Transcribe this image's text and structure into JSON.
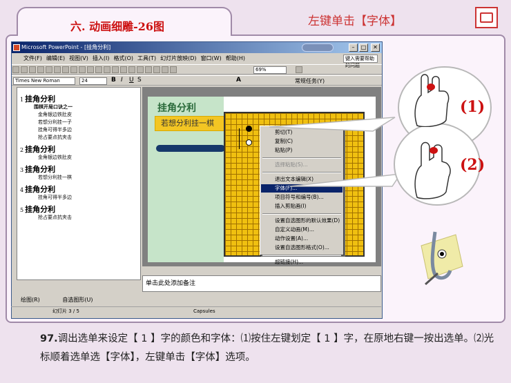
{
  "header": {
    "lesson_title": "六. 动画细雕-26图",
    "action_hint": "左键单击【字体】"
  },
  "icons": {
    "corner": "presentation-slide-icon",
    "mascot": "magnifier-mascot-icon"
  },
  "window": {
    "title": "Microsoft PowerPoint - [挂角分利]",
    "menu": [
      "文件(F)",
      "编辑(E)",
      "视图(V)",
      "插入(I)",
      "格式(O)",
      "工具(T)",
      "幻灯片放映(D)",
      "窗口(W)",
      "帮助(H)"
    ],
    "help_box": "键入需要帮助的问题",
    "font_name": "Times New Roman",
    "font_size": "24",
    "zoom": "69%",
    "task_pane": "常规任务(Y)",
    "notes_placeholder": "单击此处添加备注",
    "status_slide": "幻灯片 3 / 5",
    "status_design": "Capsules",
    "draw_label": "绘图(R)",
    "autoshape_label": "自选图形(U)"
  },
  "outline": [
    {
      "num": "1",
      "title": "挂角分利",
      "subs": [
        "围棋开局口诀之一",
        "金角银边铁肚皮",
        "若想分利挂一子",
        "挂角可得半多边",
        "抢占要点抗夹击"
      ]
    },
    {
      "num": "2",
      "title": "挂角分利",
      "subs": [
        "金角银边铁肚皮"
      ]
    },
    {
      "num": "3",
      "title": "挂角分利",
      "subs": [
        "若想分利挂一棋"
      ]
    },
    {
      "num": "4",
      "title": "挂角分利",
      "subs": [
        "挂角可得半多边"
      ]
    },
    {
      "num": "5",
      "title": "挂角分利",
      "subs": [
        "抢占要点抗夹击"
      ]
    }
  ],
  "slide": {
    "title": "挂角分利",
    "subtitle": "若想分利挂一棋"
  },
  "context_menu": {
    "items": [
      {
        "label": "剪切(T)",
        "state": "normal"
      },
      {
        "label": "复制(C)",
        "state": "normal"
      },
      {
        "label": "粘贴(P)",
        "state": "normal"
      },
      {
        "label": "选择粘贴(S)...",
        "state": "disabled"
      },
      {
        "label": "退出文本编辑(X)",
        "state": "normal"
      },
      {
        "label": "字体(F)...",
        "state": "selected"
      },
      {
        "label": "项目符号和编号(B)...",
        "state": "normal"
      },
      {
        "label": "插入剪贴画(I)",
        "state": "normal"
      },
      {
        "label": "设置自选图形的默认效果(D)",
        "state": "normal"
      },
      {
        "label": "自定义动画(M)...",
        "state": "normal"
      },
      {
        "label": "动作设置(A)...",
        "state": "normal"
      },
      {
        "label": "设置自选图形格式(O)...",
        "state": "normal"
      },
      {
        "label": "超链接(H)...",
        "state": "normal"
      }
    ]
  },
  "callouts": {
    "step1": "(1)",
    "step2": "(2)"
  },
  "caption": {
    "number": "97.",
    "text": "调出选单来设定【 1 】字的颜色和字体：⑴按住左键划定【 1 】字，在原地右键一按出选单。⑵光标顺着选单选【字体】，左键单击【字体】选项。"
  }
}
